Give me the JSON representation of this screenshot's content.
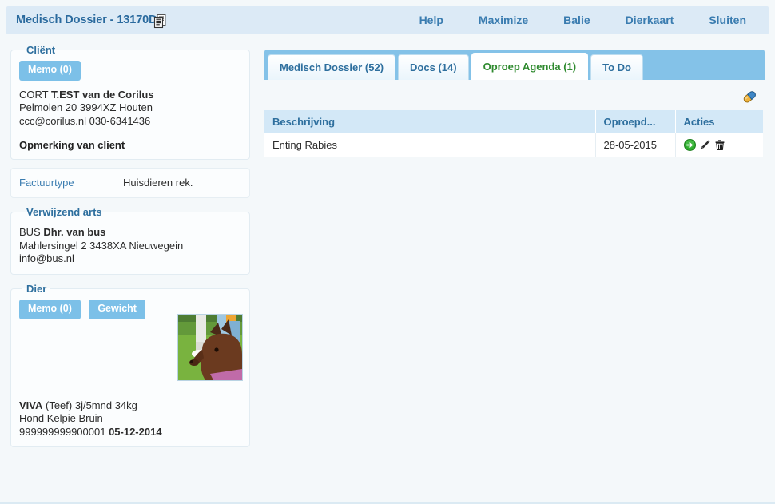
{
  "header": {
    "title": "Medisch Dossier - 13170DI",
    "doc_icon": "documents-icon",
    "nav": [
      {
        "label": "Help",
        "name": "nav-help"
      },
      {
        "label": "Maximize",
        "name": "nav-maximize"
      },
      {
        "label": "Balie",
        "name": "nav-balie"
      },
      {
        "label": "Dierkaart",
        "name": "nav-dierkaart"
      },
      {
        "label": "Sluiten",
        "name": "nav-sluiten"
      }
    ]
  },
  "sidebar": {
    "client": {
      "legend": "Cliënt",
      "memo_button": "Memo (0)",
      "name": "CORT T.EST van de Corilus",
      "name_prefix": "CORT ",
      "name_bold": "T.EST van de Corilus",
      "address": "Pelmolen 20 3994XZ Houten",
      "contact": "ccc@corilus.nl 030-6341436",
      "note": "Opmerking van client"
    },
    "factuurtype": {
      "label": "Factuurtype",
      "value": "Huisdieren rek."
    },
    "referring_vet": {
      "legend": "Verwijzend arts",
      "name_prefix": "BUS ",
      "name_bold": "Dhr. van bus",
      "address": "Mahlersingel 2 3438XA Nieuwegein",
      "email": "info@bus.nl"
    },
    "animal": {
      "legend": "Dier",
      "memo_button": "Memo (0)",
      "weight_button": "Gewicht",
      "photo_alt": "dog-photo",
      "name": "VIVA",
      "details": " (Teef) 3j/5mnd 34kg",
      "breed": "Hond Kelpie Bruin",
      "chip": "999999999900001 ",
      "chip_date": "05-12-2014"
    }
  },
  "main": {
    "tabs": [
      {
        "label": "Medisch Dossier (52)",
        "name": "tab-medisch-dossier",
        "active": false
      },
      {
        "label": "Docs (14)",
        "name": "tab-docs",
        "active": false
      },
      {
        "label": "Oproep Agenda (1)",
        "name": "tab-oproep-agenda",
        "active": true
      },
      {
        "label": "To Do",
        "name": "tab-to-do",
        "active": false
      }
    ],
    "toolbar": {
      "pill_icon": "pill-icon"
    },
    "table": {
      "columns": [
        "Beschrijving",
        "Oproepd...",
        "Acties"
      ],
      "rows": [
        {
          "beschrijving": "Enting Rabies",
          "oproepdatum": "28-05-2015",
          "actions": [
            "go-icon",
            "edit-icon",
            "delete-icon"
          ]
        }
      ]
    }
  },
  "colors": {
    "header_bg": "#dceaf6",
    "header_text": "#2a6a9e",
    "page_bg": "#f4f8fa",
    "tabstrip_bg": "#84c2e8",
    "tab_active_text": "#2f8a2f",
    "tab_text": "#2e6f9e",
    "button_bg": "#7cc0e8",
    "table_header_bg": "#d3e8f7",
    "go_icon": "#22aa22",
    "panel_border": "#e2ecf2"
  }
}
